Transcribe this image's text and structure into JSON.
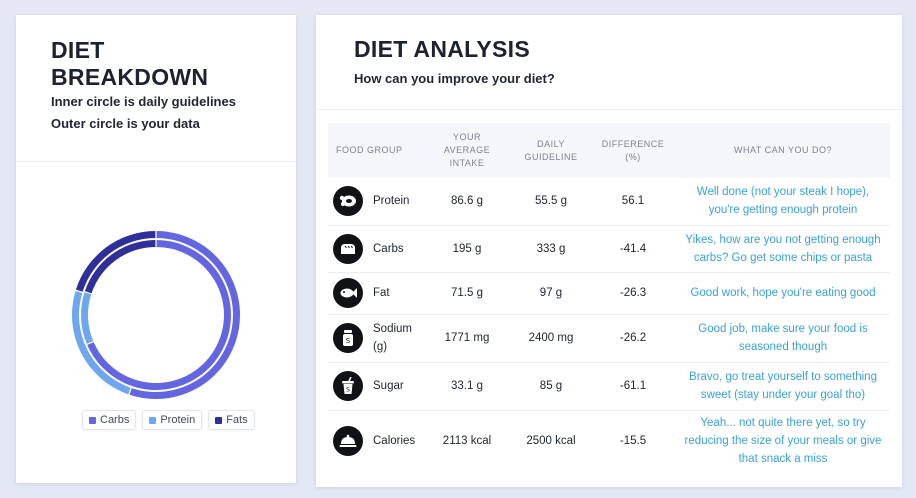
{
  "breakdown": {
    "title_line1": "DIET",
    "title_line2": "BREAKDOWN",
    "inner_note": "Inner circle is daily guidelines",
    "outer_note": "Outer circle is your data",
    "legend": [
      {
        "label": "Carbs",
        "color": "#6366e0"
      },
      {
        "label": "Protein",
        "color": "#6ea6ef"
      },
      {
        "label": "Fats",
        "color": "#2f2f9a"
      }
    ],
    "chart_data": {
      "type": "donut",
      "rings": [
        {
          "name": "daily guidelines",
          "ring": "inner",
          "values": {
            "Carbs": 333,
            "Protein": 55.5,
            "Fats": 97
          }
        },
        {
          "name": "your data",
          "ring": "outer",
          "values": {
            "Carbs": 195,
            "Protein": 86.6,
            "Fats": 71.5
          }
        }
      ]
    }
  },
  "analysis": {
    "title": "DIET ANALYSIS",
    "subtitle": "How can you improve your diet?",
    "headers": {
      "food_group": "FOOD GROUP",
      "intake_l1": "YOUR",
      "intake_l2": "AVERAGE",
      "intake_l3": "INTAKE",
      "guide_l1": "DAILY",
      "guide_l2": "GUIDELINE",
      "diff_l1": "DIFFERENCE",
      "diff_l2": "(%)",
      "action": "WHAT CAN YOU DO?"
    },
    "rows": [
      {
        "icon": "chicken-icon",
        "food": "Protein",
        "intake": "86.6 g",
        "guideline": "55.5 g",
        "difference": "56.1",
        "tip": "Well done (not your steak I hope), you're getting enough protein"
      },
      {
        "icon": "bread-icon",
        "food": "Carbs",
        "intake": "195 g",
        "guideline": "333 g",
        "difference": "-41.4",
        "tip": "Yikes, how are you not getting enough carbs? Go get some chips or pasta"
      },
      {
        "icon": "fish-icon",
        "food": "Fat",
        "intake": "71.5 g",
        "guideline": "97 g",
        "difference": "-26.3",
        "tip": "Good work, hope you're eating good"
      },
      {
        "icon": "salt-shaker-icon",
        "food": "Sodium (g)",
        "intake": "1771 mg",
        "guideline": "2400 mg",
        "difference": "-26.2",
        "tip": "Good job, make sure your food is seasoned though"
      },
      {
        "icon": "soda-cup-icon",
        "food": "Sugar",
        "intake": "33.1 g",
        "guideline": "85 g",
        "difference": "-61.1",
        "tip": "Bravo, go treat yourself to something sweet (stay under your goal tho)"
      },
      {
        "icon": "cloche-icon",
        "food": "Calories",
        "intake": "2113 kcal",
        "guideline": "2500 kcal",
        "difference": "-15.5",
        "tip": "Yeah... not quite there yet, so try reducing the size of your meals or give that snack a miss"
      }
    ]
  }
}
